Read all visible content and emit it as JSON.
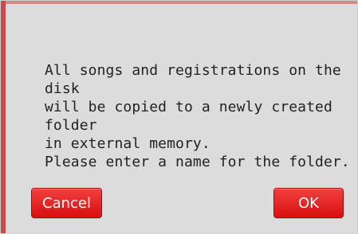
{
  "dialog": {
    "message": "All songs and registrations on the disk\nwill be copied to a newly created folder\nin external memory.\nPlease enter a name for the folder.",
    "cancel_label": "Cancel",
    "ok_label": "OK"
  },
  "colors": {
    "button_red": "#e52424",
    "background": "#dcdcdc",
    "text": "#222222"
  }
}
